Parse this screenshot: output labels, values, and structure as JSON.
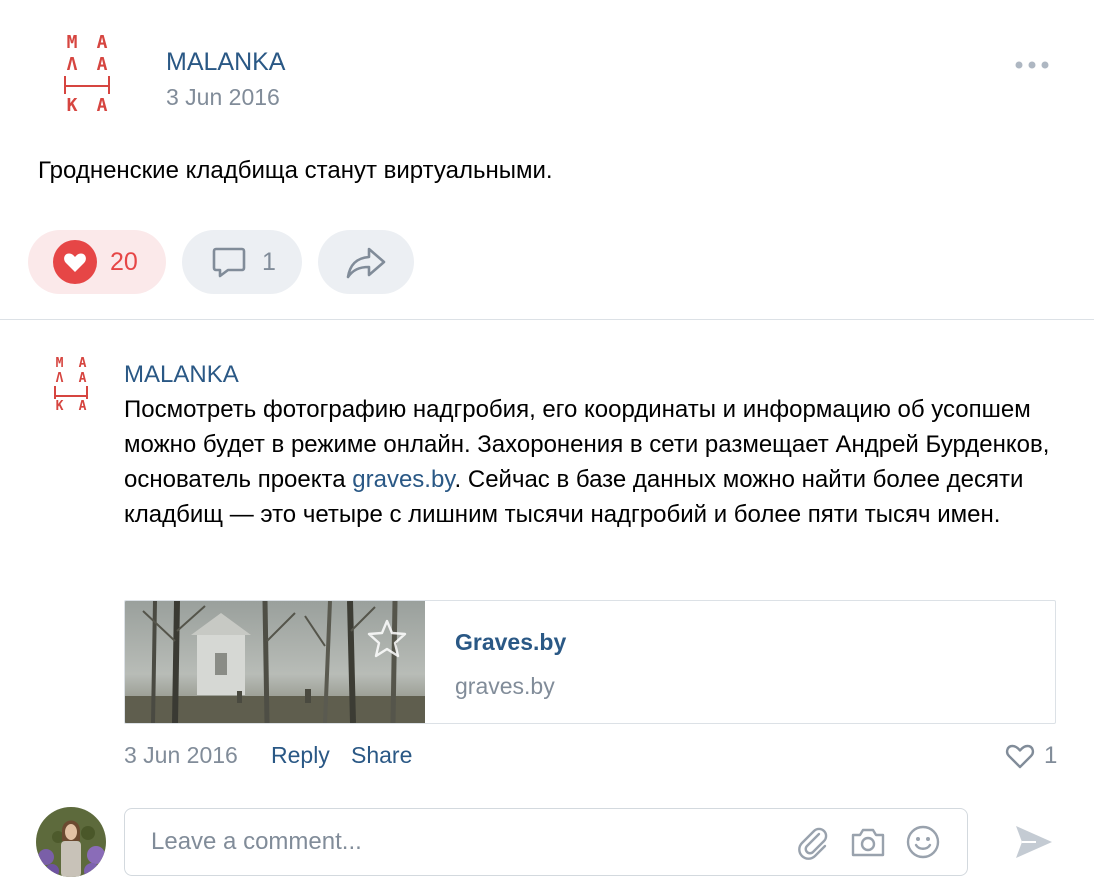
{
  "post": {
    "author": "MALANKA",
    "date": "3 Jun 2016",
    "text": "Гродненские кладбища станут виртуальными.",
    "likes": "20",
    "comments": "1",
    "logo": {
      "rows": [
        [
          "M",
          "A"
        ],
        [
          "Λ",
          "A"
        ],
        [
          "K",
          "A"
        ]
      ]
    }
  },
  "comment": {
    "author": "MALANKA",
    "text_before": "Посмотреть фотографию надгробия, его координаты и информацию об усопшем можно будет в режиме онлайн. Захоронения в сети размещает Андрей Бурденков, основатель проекта ",
    "link_text": "graves.by",
    "text_after": ". Сейчас в базе данных можно найти более десяти кладбищ — это четыре с лишним тысячи надгробий и более пяти тысяч имен.",
    "card": {
      "title": "Graves.by",
      "domain": "graves.by"
    },
    "date": "3 Jun 2016",
    "reply": "Reply",
    "share": "Share",
    "likes": "1"
  },
  "composer": {
    "placeholder": "Leave a comment..."
  },
  "colors": {
    "accent": "#2a5885",
    "like": "#e64646",
    "logo": "#d64540"
  },
  "icons": [
    "more-icon",
    "heart-icon",
    "comment-icon",
    "share-icon",
    "star-icon",
    "heart-outline-icon",
    "paperclip-icon",
    "camera-icon",
    "smile-icon",
    "send-icon"
  ]
}
